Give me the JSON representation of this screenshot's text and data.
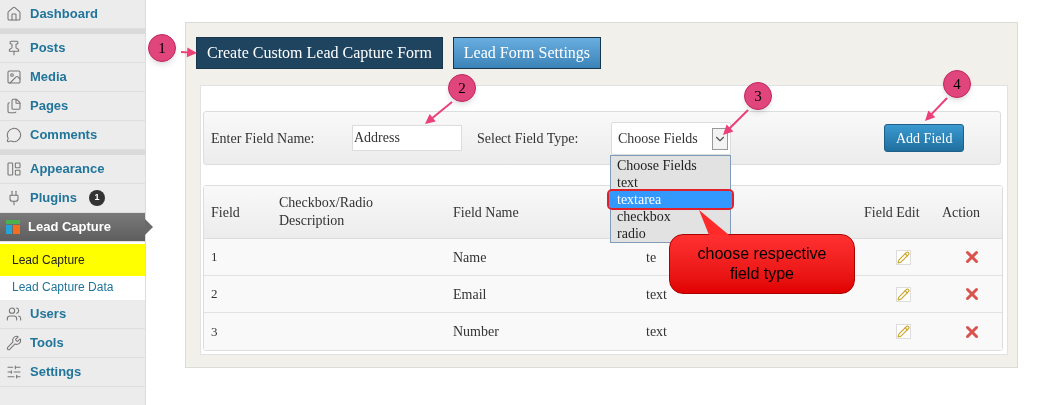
{
  "sidebar": {
    "groups": [
      {
        "items": [
          {
            "label": "Dashboard",
            "selected": false
          }
        ]
      },
      {
        "items": [
          {
            "label": "Posts",
            "selected": false
          },
          {
            "label": "Media",
            "selected": false
          },
          {
            "label": "Pages",
            "selected": false
          },
          {
            "label": "Comments",
            "selected": false
          }
        ]
      },
      {
        "items": [
          {
            "label": "Appearance",
            "selected": false
          },
          {
            "label": "Plugins",
            "badge": "1",
            "selected": false
          },
          {
            "label": "Lead Capture",
            "selected": true,
            "children": [
              {
                "label": "Lead Capture",
                "selected": true
              },
              {
                "label": "Lead Capture Data",
                "selected": false
              }
            ]
          },
          {
            "label": "Users",
            "selected": false
          },
          {
            "label": "Tools",
            "selected": false
          },
          {
            "label": "Settings",
            "selected": false
          }
        ]
      }
    ]
  },
  "tabs": [
    {
      "label": "Create Custom Lead Capture Form",
      "selected": true
    },
    {
      "label": "Lead Form Settings",
      "selected": false
    }
  ],
  "field_bar": {
    "name_label": "Enter Field Name:",
    "name_value": "Address",
    "type_label": "Select Field Type:",
    "type_value": "Choose Fields",
    "add_button": "Add Field",
    "dropdown_options": [
      {
        "label": "Choose Fields",
        "selected": false
      },
      {
        "label": "text",
        "selected": false
      },
      {
        "label": "textarea",
        "selected": true
      },
      {
        "label": "checkbox",
        "selected": false
      },
      {
        "label": "radio",
        "selected": false
      }
    ]
  },
  "table": {
    "columns": [
      "Field",
      "Checkbox/Radio Description",
      "Field Name",
      "Field Edit",
      "Action"
    ],
    "rows": [
      {
        "field": "1",
        "description": "",
        "name": "Name",
        "type": "te"
      },
      {
        "field": "2",
        "description": "",
        "name": "Email",
        "type": "text"
      },
      {
        "field": "3",
        "description": "",
        "name": "Number",
        "type": "text"
      }
    ]
  },
  "annotations": {
    "markers": [
      "1",
      "2",
      "3",
      "4"
    ],
    "callout": "choose respective field type"
  }
}
